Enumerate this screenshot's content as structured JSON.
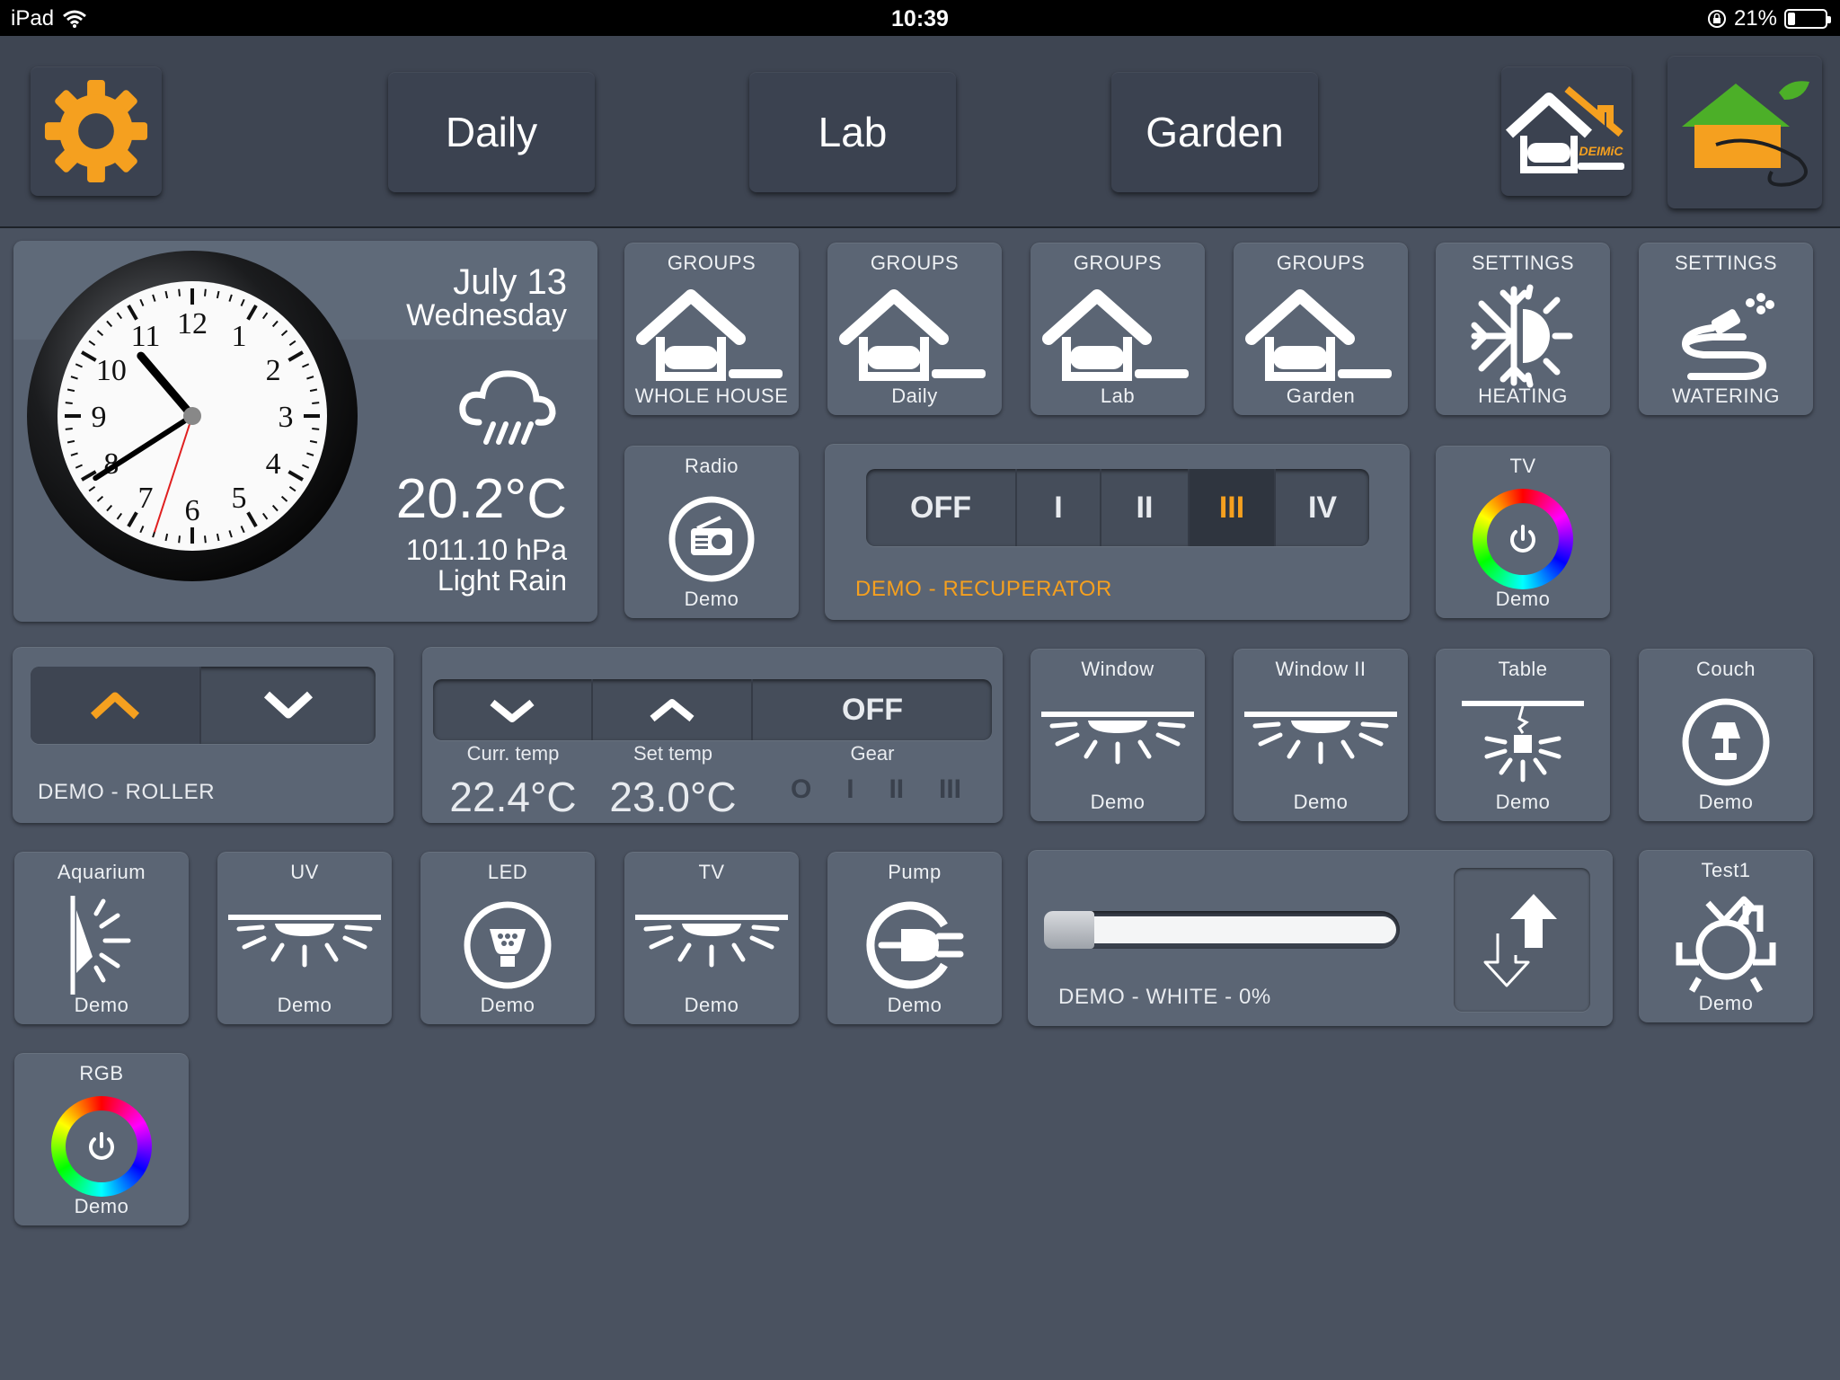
{
  "status_bar": {
    "device": "iPad",
    "time": "10:39",
    "battery": "21%",
    "battery_level": 0.21
  },
  "nav": {
    "buttons": [
      "Daily",
      "Lab",
      "Garden"
    ],
    "settings_icon": "gear-icon",
    "home_icon": "deimic-home-icon",
    "garden_icon": "garden-home-icon"
  },
  "weather": {
    "date": "July 13",
    "weekday": "Wednesday",
    "temperature": "20.2°C",
    "pressure": "1011.10 hPa",
    "condition": "Light Rain",
    "clock": {
      "hour": 10,
      "minute": 39,
      "second": 33
    }
  },
  "group_tiles": [
    {
      "top": "GROUPS",
      "bottom": "WHOLE HOUSE",
      "icon": "house-group-icon"
    },
    {
      "top": "GROUPS",
      "bottom": "Daily",
      "icon": "house-group-icon"
    },
    {
      "top": "GROUPS",
      "bottom": "Lab",
      "icon": "house-group-icon"
    },
    {
      "top": "GROUPS",
      "bottom": "Garden",
      "icon": "house-group-icon"
    },
    {
      "top": "SETTINGS",
      "bottom": "HEATING",
      "icon": "heating-icon"
    },
    {
      "top": "SETTINGS",
      "bottom": "WATERING",
      "icon": "watering-icon"
    }
  ],
  "radio": {
    "top": "Radio",
    "bottom": "Demo"
  },
  "recuperator": {
    "options": [
      "OFF",
      "I",
      "II",
      "III",
      "IV"
    ],
    "selected": "III",
    "label": "DEMO - RECUPERATOR"
  },
  "tv_rgb": {
    "top": "TV",
    "bottom": "Demo"
  },
  "roller": {
    "label": "DEMO - ROLLER"
  },
  "thermostat": {
    "curr_label": "Curr. temp",
    "set_label": "Set temp",
    "gear_label": "Gear",
    "curr_value": "22.4°C",
    "set_value": "23.0°C",
    "gear_value": "OFF",
    "gear_levels": [
      "O",
      "I",
      "II",
      "III"
    ]
  },
  "light_tiles": [
    {
      "top": "Window",
      "bottom": "Demo",
      "icon": "ceiling-light-icon"
    },
    {
      "top": "Window II",
      "bottom": "Demo",
      "icon": "ceiling-light-icon"
    },
    {
      "top": "Table",
      "bottom": "Demo",
      "icon": "pendant-lamp-icon"
    },
    {
      "top": "Couch",
      "bottom": "Demo",
      "icon": "table-lamp-icon"
    }
  ],
  "row4_tiles": [
    {
      "top": "Aquarium",
      "bottom": "Demo",
      "icon": "wall-light-icon"
    },
    {
      "top": "UV",
      "bottom": "Demo",
      "icon": "ceiling-light-icon"
    },
    {
      "top": "LED",
      "bottom": "Demo",
      "icon": "led-bulb-icon"
    },
    {
      "top": "TV",
      "bottom": "Demo",
      "icon": "ceiling-light-icon"
    },
    {
      "top": "Pump",
      "bottom": "Demo",
      "icon": "plug-icon"
    }
  ],
  "dimmer": {
    "label": "DEMO - WHITE - 0%",
    "level": 0
  },
  "test1": {
    "top": "Test1",
    "bottom": "Demo"
  },
  "rgb": {
    "top": "RGB",
    "bottom": "Demo"
  },
  "colors": {
    "accent": "#f5a01f",
    "background": "#4a5260",
    "tile": "#5b6574",
    "topbar": "#3e4552"
  }
}
